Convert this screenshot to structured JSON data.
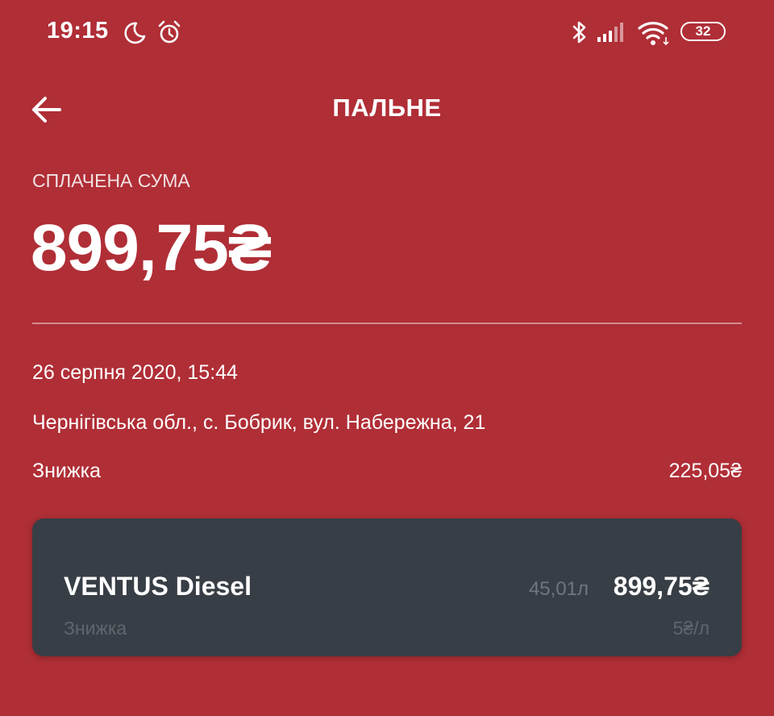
{
  "status_bar": {
    "time": "19:15",
    "battery": "32",
    "icons": [
      "moon-icon",
      "alarm-icon",
      "bluetooth-icon",
      "signal-icon",
      "wifi-icon",
      "battery-icon"
    ]
  },
  "header": {
    "back_icon": "arrow-left-icon",
    "title": "ПАЛЬНЕ"
  },
  "payment": {
    "label": "СПЛАЧЕНА СУМА",
    "amount": "899,75₴"
  },
  "details": {
    "date": "26 серпня 2020, 15:44",
    "address": "Чернігівська обл., с. Бобрик, вул. Набережна, 21",
    "discount_label": "Знижка",
    "discount_value": "225,05₴"
  },
  "fuel_item": {
    "name": "VENTUS Diesel",
    "volume": "45,01л",
    "price": "899,75₴",
    "discount_label": "Знижка",
    "discount_value": "5₴/л"
  },
  "colors": {
    "background": "#b02e36",
    "card": "#383e45",
    "text": "#ffffff",
    "muted": "#6f767d"
  }
}
